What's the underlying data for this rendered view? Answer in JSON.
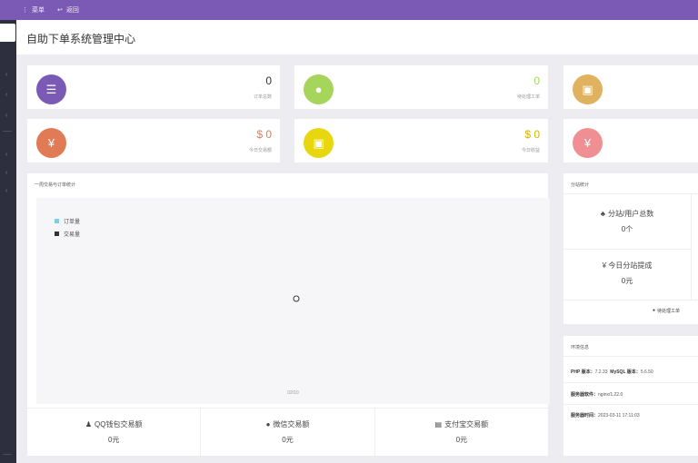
{
  "topbar": {
    "menu_label": "菜单",
    "back_label": "返回"
  },
  "header": {
    "title": "自助下单系统管理中心"
  },
  "stats": [
    {
      "value": "0",
      "label": "订单总数",
      "color": "#7b5ab6",
      "value_color": "#333333",
      "icon": "list-icon"
    },
    {
      "value": "0",
      "label": "待处理工单",
      "color": "#a6d55c",
      "value_color": "#a6d55c",
      "icon": "ticket-icon"
    },
    {
      "value": "",
      "label": "",
      "color": "#e0b15f",
      "value_color": "#333333",
      "icon": "briefcase-icon"
    },
    {
      "value": "$ 0",
      "label": "今日交易额",
      "color": "#e07b55",
      "value_color": "#e07b55",
      "icon": "yen-icon"
    },
    {
      "value": "$ 0",
      "label": "今日收益",
      "color": "#e8d60e",
      "value_color": "#e0b000",
      "icon": "briefcase-icon"
    },
    {
      "value": "",
      "label": "",
      "color": "#f08f93",
      "value_color": "#333333",
      "icon": "yen-icon"
    }
  ],
  "chart_panel": {
    "title": "一周交易与订单统计",
    "legend": [
      {
        "name": "订单量",
        "color": "#7ecfe0"
      },
      {
        "name": "交易量",
        "color": "#333333"
      }
    ],
    "x_label": "02/10"
  },
  "chart_data": {
    "type": "line",
    "x": [
      "02/10"
    ],
    "series": [
      {
        "name": "订单量",
        "values": [
          0
        ]
      },
      {
        "name": "交易量",
        "values": [
          0
        ]
      }
    ],
    "title": "一周交易与订单统计",
    "grid": false,
    "legend_placement": "top-left"
  },
  "payments": [
    {
      "label": "QQ钱包交易额",
      "value": "0元",
      "icon": "qq-icon"
    },
    {
      "label": "微信交易额",
      "value": "0元",
      "icon": "wechat-icon"
    },
    {
      "label": "支付宝交易额",
      "value": "0元",
      "icon": "card-icon"
    }
  ],
  "site_panel": {
    "title": "分站统计",
    "users_label": "分站/用户总数",
    "users_value": "0个",
    "commission_label": "¥ 今日分站提成",
    "commission_value": "0元",
    "ticket_label": "待处理工单"
  },
  "env_panel": {
    "title": "环境信息",
    "php_label": "PHP 版本：",
    "php_value": "7.2.33",
    "mysql_label": "MySQL 版本：",
    "mysql_value": "5.6.50",
    "server_label": "服务器软件：",
    "server_value": "nginx/1.22.0",
    "time_label": "服务器时间：",
    "time_value": "2023-03-11 17:11:03"
  }
}
